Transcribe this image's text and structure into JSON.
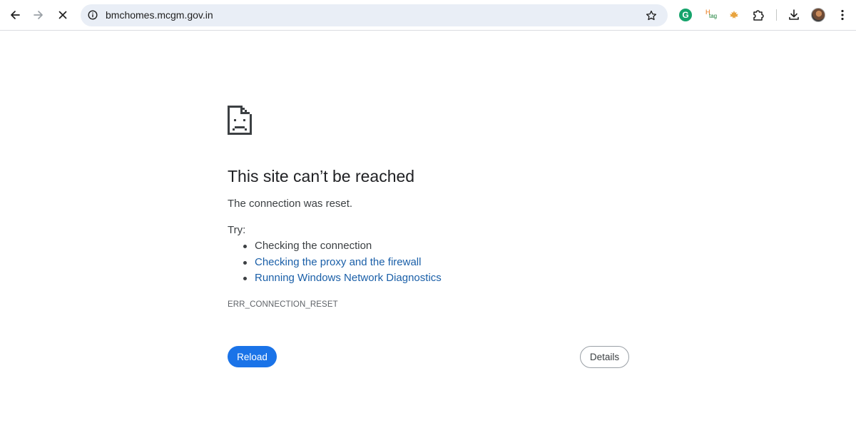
{
  "browser": {
    "url": "bmchomes.mcgm.gov.in",
    "nav_icons": [
      "back-arrow-icon",
      "forward-arrow-icon",
      "stop-loading-icon"
    ],
    "extension_icons": [
      "grammarly-icon",
      "hashtag-extension-icon",
      "maple-leaf-extension-icon",
      "puzzle-extensions-icon"
    ],
    "toolbar_icons": [
      "download-icon",
      "profile-avatar",
      "more-options-icon"
    ]
  },
  "error": {
    "title": "This site can’t be reached",
    "subtitle": "The connection was reset.",
    "try_label": "Try:",
    "suggestions": [
      {
        "text": "Checking the connection",
        "link": false
      },
      {
        "text": "Checking the proxy and the firewall",
        "link": true
      },
      {
        "text": "Running Windows Network Diagnostics",
        "link": true
      }
    ],
    "code": "ERR_CONNECTION_RESET",
    "reload_label": "Reload",
    "details_label": "Details"
  },
  "colors": {
    "accent": "#1a73e8",
    "link": "#1a5fa8",
    "omnibox_bg": "#e9eef6",
    "text": "#202124"
  }
}
